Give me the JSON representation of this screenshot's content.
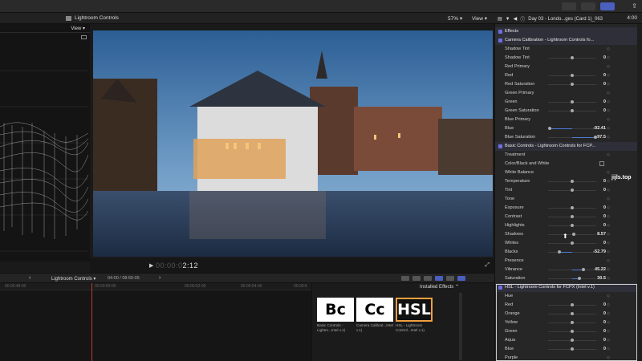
{
  "app": {
    "library_title": "Lightroom Controls",
    "zoom_level": "57%",
    "view_label": "View",
    "clip_name": "Day 03 - Londo...ges (Card 1)_063",
    "clip_duration": "4:00"
  },
  "scope": {
    "view_label": "View"
  },
  "viewer": {
    "timecode_dim": "00:00:0",
    "timecode_bright": "2:12"
  },
  "timeline": {
    "project_name": "Lightroom Controls",
    "duration": "04:00 / 08:55:05",
    "ruler_ticks": [
      "00:00:48:00",
      "00:00:50:00",
      "00:00:52:00",
      "00:00:54:00",
      "00:00:5"
    ]
  },
  "effects_browser": {
    "header": "Installed Effects",
    "items": [
      {
        "thumb": "Bc",
        "label": "Basic Controls - Lightro...Intel v.1)"
      },
      {
        "thumb": "Cc",
        "label": "Camera Calibrat...Intel v.1)"
      },
      {
        "thumb": "HSL",
        "label": "HSL - Lightroom Control...Intel v.1)"
      }
    ]
  },
  "inspector": {
    "rows": [
      {
        "type": "section",
        "label": "Effects"
      },
      {
        "type": "section",
        "label": "Camera Calibration - Lightroom Controls fo..."
      },
      {
        "type": "param",
        "label": "Shadow Tint",
        "value": "",
        "slider": false
      },
      {
        "type": "param",
        "label": "Shadow Tint",
        "value": "0",
        "slider": true,
        "pos": 0.5
      },
      {
        "type": "param",
        "label": "Red Primary",
        "value": "",
        "slider": false
      },
      {
        "type": "param",
        "label": "Red",
        "value": "0",
        "slider": true,
        "pos": 0.5
      },
      {
        "type": "param",
        "label": "Red Saturation",
        "value": "0",
        "slider": true,
        "pos": 0.5
      },
      {
        "type": "param",
        "label": "Green Primary",
        "value": "",
        "slider": false
      },
      {
        "type": "param",
        "label": "Green",
        "value": "0",
        "slider": true,
        "pos": 0.5
      },
      {
        "type": "param",
        "label": "Green Saturation",
        "value": "0",
        "slider": true,
        "pos": 0.5
      },
      {
        "type": "param",
        "label": "Blue Primary",
        "value": "",
        "slider": false
      },
      {
        "type": "param",
        "label": "Blue",
        "value": "-92.41",
        "slider": true,
        "pos": 0.04,
        "fill": true
      },
      {
        "type": "param",
        "label": "Blue Saturation",
        "value": "97.5",
        "slider": true,
        "pos": 0.98,
        "fill": true
      },
      {
        "type": "section",
        "label": "Basic Controls - Lightroom Controls for FCP..."
      },
      {
        "type": "param",
        "label": "Treatment",
        "value": "",
        "slider": false
      },
      {
        "type": "check",
        "label": "Color/Black and White"
      },
      {
        "type": "param",
        "label": "White Balance",
        "value": "",
        "slider": false
      },
      {
        "type": "param",
        "label": "Temperature",
        "value": "0",
        "slider": true,
        "pos": 0.5
      },
      {
        "type": "param",
        "label": "Tint",
        "value": "0",
        "slider": true,
        "pos": 0.5
      },
      {
        "type": "param",
        "label": "Tone",
        "value": "",
        "slider": false
      },
      {
        "type": "param",
        "label": "Exposure",
        "value": "0",
        "slider": true,
        "pos": 0.5
      },
      {
        "type": "param",
        "label": "Contrast",
        "value": "0",
        "slider": true,
        "pos": 0.5
      },
      {
        "type": "param",
        "label": "Highlights",
        "value": "0",
        "slider": true,
        "pos": 0.5
      },
      {
        "type": "param",
        "label": "Shadows",
        "value": "8.57",
        "slider": true,
        "pos": 0.54
      },
      {
        "type": "param",
        "label": "Whites",
        "value": "0",
        "slider": true,
        "pos": 0.5
      },
      {
        "type": "param",
        "label": "Blacks",
        "value": "-52.79",
        "slider": true,
        "pos": 0.24,
        "fill": true
      },
      {
        "type": "param",
        "label": "Presence",
        "value": "",
        "slider": false
      },
      {
        "type": "param",
        "label": "Vibrance",
        "value": "45.22",
        "slider": true,
        "pos": 0.73,
        "fill": true
      },
      {
        "type": "param",
        "label": "Saturation",
        "value": "30.5",
        "slider": true,
        "pos": 0.65,
        "fill": true
      },
      {
        "type": "section",
        "label": "HSL - Lightroom Controls for FCPX (Intel v.1)"
      },
      {
        "type": "param",
        "label": "Hue",
        "value": "",
        "slider": false
      },
      {
        "type": "param",
        "label": "Red",
        "value": "0",
        "slider": true,
        "pos": 0.5
      },
      {
        "type": "param",
        "label": "Orange",
        "value": "0",
        "slider": true,
        "pos": 0.5
      },
      {
        "type": "param",
        "label": "Yellow",
        "value": "0",
        "slider": true,
        "pos": 0.5
      },
      {
        "type": "param",
        "label": "Green",
        "value": "0",
        "slider": true,
        "pos": 0.5
      },
      {
        "type": "param",
        "label": "Aqua",
        "value": "0",
        "slider": true,
        "pos": 0.5
      },
      {
        "type": "param",
        "label": "Blue",
        "value": "0",
        "slider": true,
        "pos": 0.5
      },
      {
        "type": "param",
        "label": "Purple",
        "value": "",
        "slider": false
      }
    ]
  },
  "watermark": "jijls.top",
  "colors": {
    "accent": "#4b5fbf",
    "playhead": "#c0392b",
    "highlight": "#f0a040"
  }
}
